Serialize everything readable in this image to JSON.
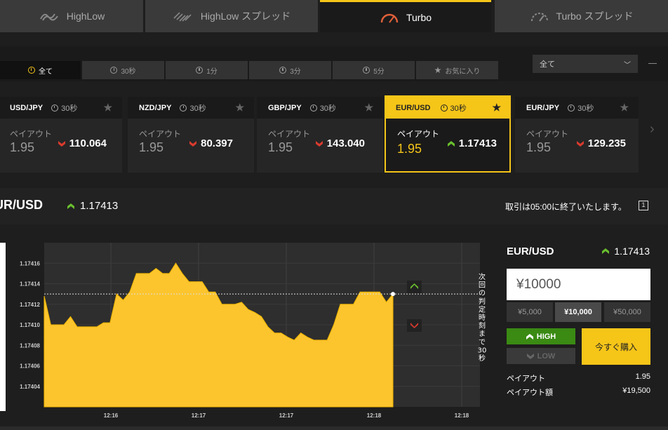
{
  "top_tabs": [
    {
      "label": "HighLow"
    },
    {
      "label": "HighLow スプレッド"
    },
    {
      "label": "Turbo"
    },
    {
      "label": "Turbo スプレッド"
    }
  ],
  "filter_tabs": [
    {
      "label": "全て"
    },
    {
      "label": "30秒"
    },
    {
      "label": "1分"
    },
    {
      "label": "3分"
    },
    {
      "label": "5分"
    },
    {
      "label": "お気に入り"
    }
  ],
  "filter_select": {
    "value": "全て"
  },
  "cards": [
    {
      "pair": "USD/JPY",
      "period": "30秒",
      "payout_label": "ペイアウト",
      "payout": "1.95",
      "rate": "110.064",
      "direction": "down"
    },
    {
      "pair": "NZD/JPY",
      "period": "30秒",
      "payout_label": "ペイアウト",
      "payout": "1.95",
      "rate": "80.397",
      "direction": "down"
    },
    {
      "pair": "GBP/JPY",
      "period": "30秒",
      "payout_label": "ペイアウト",
      "payout": "1.95",
      "rate": "143.040",
      "direction": "down"
    },
    {
      "pair": "EUR/USD",
      "period": "30秒",
      "payout_label": "ペイアウト",
      "payout": "1.95",
      "rate": "1.17413",
      "direction": "up"
    },
    {
      "pair": "EUR/JPY",
      "period": "30秒",
      "payout_label": "ペイアウト",
      "payout": "1.95",
      "rate": "129.235",
      "direction": "down"
    }
  ],
  "asset_header": {
    "name": "UR/USD",
    "rate": "1.17413",
    "trade_info": "取引は05:00に終了いたします。",
    "info_icon": "1"
  },
  "chart_data": {
    "type": "area",
    "y_ticks": [
      "1.17416",
      "1.17414",
      "1.17412",
      "1.17410",
      "1.17408",
      "1.17406",
      "1.17404"
    ],
    "x_ticks": [
      "12:16",
      "12:17",
      "12:17",
      "12:18",
      "12:18"
    ],
    "ylim": [
      1.17402,
      1.17418
    ],
    "strike_label": "次回の判定時刻まで30秒",
    "series": [
      {
        "values": [
          1.174128,
          1.1741,
          1.1741,
          1.1741,
          1.174108,
          1.174098,
          1.174098,
          1.174098,
          1.174098,
          1.174102,
          1.174102,
          1.17413,
          1.174124,
          1.174132,
          1.17415,
          1.17415,
          1.17415,
          1.174155,
          1.17415,
          1.17415,
          1.17416,
          1.17415,
          1.174142,
          1.174142,
          1.174142,
          1.174132,
          1.174132,
          1.17412,
          1.17412,
          1.17412,
          1.174122,
          1.174115,
          1.174112,
          1.174108,
          1.174098,
          1.174092,
          1.174092,
          1.174088,
          1.174085,
          1.174092,
          1.174088,
          1.174085,
          1.174085,
          1.174085,
          1.1741,
          1.17412,
          1.17412,
          1.17412,
          1.174132,
          1.174132,
          1.174132,
          1.174132,
          1.174122,
          1.17413
        ]
      }
    ],
    "last_value": 1.17413
  },
  "trade_panel": {
    "pair": "EUR/USD",
    "rate": "1.17413",
    "amount": "¥10000",
    "amount_options": [
      "¥5,000",
      "¥10,000",
      "¥50,000"
    ],
    "high_label": "HIGH",
    "low_label": "LOW",
    "buy_label": "今すぐ購入",
    "payout_label": "ペイアウト",
    "payout_value": "1.95",
    "payout_amount_label": "ペイアウト額",
    "payout_amount_value": "¥19,500"
  },
  "colors": {
    "accent": "#f5c518",
    "up": "#6abf2e",
    "down": "#d93b2e",
    "high": "#3a8a13"
  }
}
